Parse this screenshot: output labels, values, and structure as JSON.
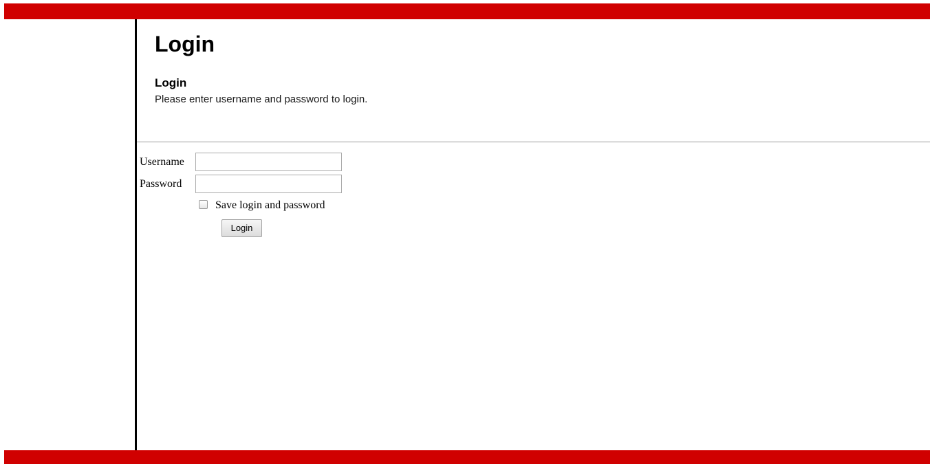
{
  "page": {
    "title": "Login"
  },
  "login_section": {
    "title": "Login",
    "instructions": "Please enter username and password to login."
  },
  "form": {
    "username_label": "Username",
    "username_value": "",
    "password_label": "Password",
    "password_value": "",
    "remember_label": "Save login and password",
    "remember_checked": false,
    "submit_label": "Login"
  },
  "colors": {
    "header_bar": "#d00000",
    "footer_bar": "#d00000",
    "side_rule": "#000000",
    "divider": "#9a9a9a"
  }
}
